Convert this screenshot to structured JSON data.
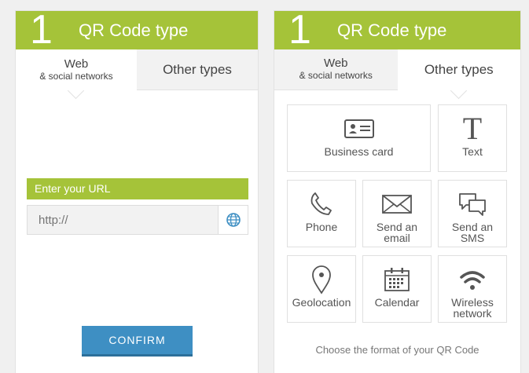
{
  "left_panel": {
    "step_number": "1",
    "title": "QR Code type",
    "tab_web_line1": "Web",
    "tab_web_line2": "& social networks",
    "tab_other": "Other types",
    "url_label": "Enter your URL",
    "url_placeholder": "http://",
    "confirm_label": "CONFIRM"
  },
  "right_panel": {
    "step_number": "1",
    "title": "QR Code type",
    "tab_web_line1": "Web",
    "tab_web_line2": "& social networks",
    "tab_other": "Other types",
    "tiles": {
      "business_card": "Business card",
      "text": "Text",
      "phone": "Phone",
      "email_line1": "Send an",
      "email_line2": "email",
      "sms_line1": "Send an",
      "sms_line2": "SMS",
      "geolocation": "Geolocation",
      "calendar": "Calendar",
      "wireless_line1": "Wireless",
      "wireless_line2": "network"
    },
    "footer_hint": "Choose the format of your QR Code"
  },
  "colors": {
    "accent_green": "#a5c339",
    "button_blue": "#3e8fc3",
    "globe_blue": "#3e8fc3"
  }
}
